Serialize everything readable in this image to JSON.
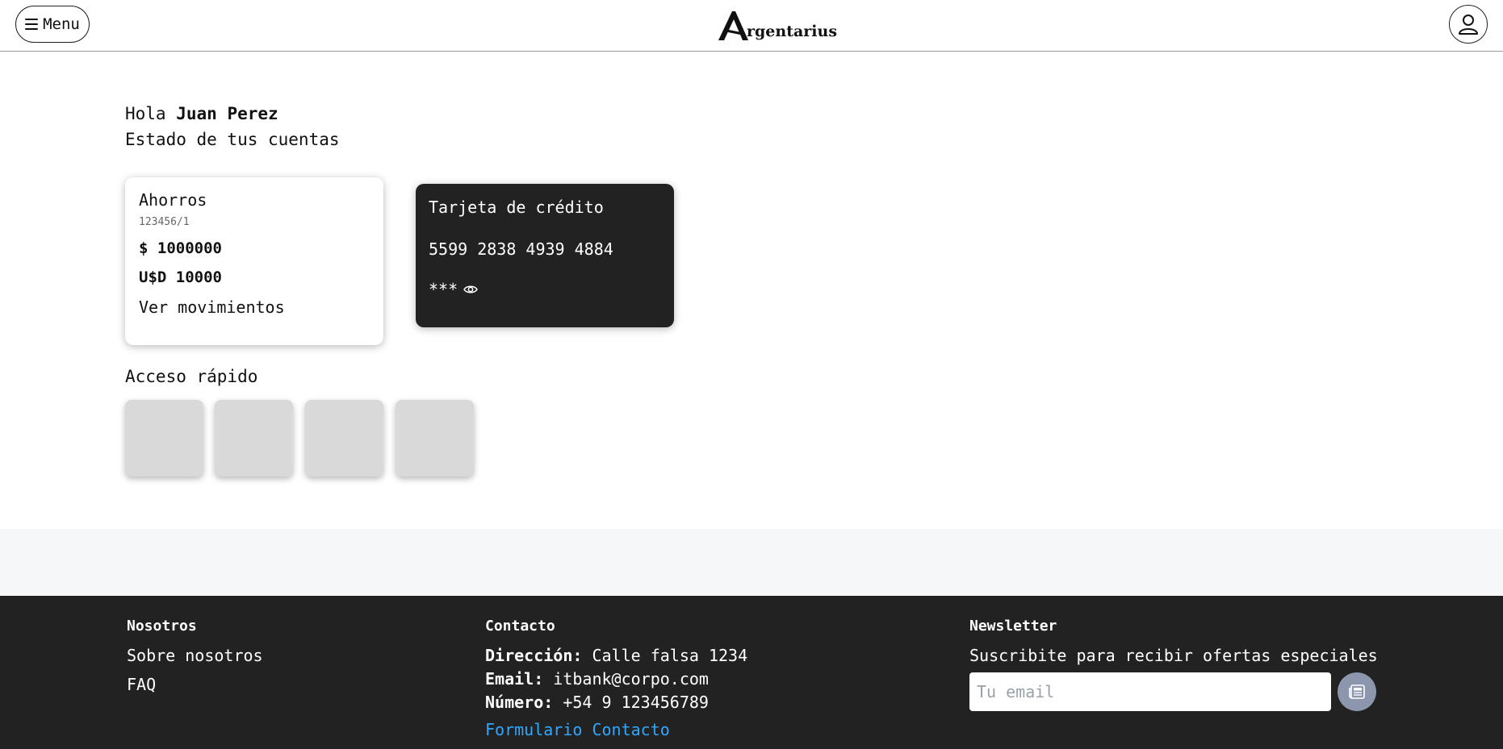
{
  "header": {
    "menu_label": "Menu",
    "logo_letter": "A",
    "logo_text": "rgentarius"
  },
  "greeting": {
    "hello": "Hola",
    "user_name": "Juan Perez",
    "subtitle": "Estado de tus cuentas"
  },
  "savings_card": {
    "title": "Ahorros",
    "account_number": "123456/1",
    "balance_ars": "$ 1000000",
    "balance_usd": "U$D 10000",
    "link": "Ver movimientos"
  },
  "credit_card": {
    "title": "Tarjeta de crédito",
    "number": "5599 2838 4939 4884",
    "cvv_masked": "***",
    "reveal_icon": "eye-icon"
  },
  "quick_access": {
    "title": "Acceso rápido",
    "tiles": 4
  },
  "footer": {
    "about": {
      "heading": "Nosotros",
      "links": [
        "Sobre nosotros",
        "FAQ"
      ]
    },
    "contact": {
      "heading": "Contacto",
      "address_label": "Dirección:",
      "address_value": "Calle falsa 1234",
      "email_label": "Email:",
      "email_value": "itbank@corpo.com",
      "phone_label": "Número:",
      "phone_value": "+54 9 123456789",
      "form_link": "Formulario Contacto"
    },
    "newsletter": {
      "heading": "Newsletter",
      "text": "Suscribite para recibir ofertas especiales",
      "placeholder": "Tu email",
      "button_icon": "newspaper-icon"
    }
  },
  "colors": {
    "dark": "#222222",
    "band": "#f6f7f9",
    "link_blue": "#2ea8ff",
    "newsletter_btn": "#8c97ad",
    "tile": "#d9d9d9"
  }
}
